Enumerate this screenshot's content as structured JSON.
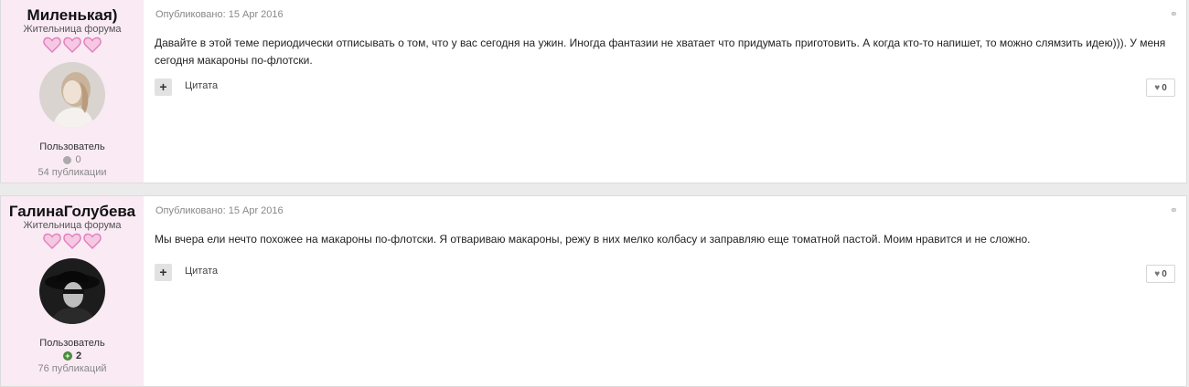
{
  "posts": [
    {
      "author": {
        "name": "Миленькая)",
        "title": "Жительница форума",
        "group": "Пользователь",
        "reputation": "0",
        "publications": "54 публикации"
      },
      "published": "Опубликовано: 15 Apr 2016",
      "text": "Давайте в этой теме периодически отписывать о том, что у вас сегодня на ужин. Иногда фантазии не хватает что придумать приготовить. А когда кто-то напишет, то можно слямзить идею))). У меня сегодня макароны по-флотски.",
      "quote_label": "Цитата",
      "multiquote_label": "+",
      "likes": "0"
    },
    {
      "author": {
        "name": "ГалинаГолубева",
        "title": "Жительница форума",
        "group": "Пользователь",
        "reputation": "2",
        "publications": "76 публикаций"
      },
      "published": "Опубликовано: 15 Apr 2016",
      "text": "Мы вчера ели нечто похожее на макароны по-флотски. Я отвариваю макароны, режу в них мелко колбасу и заправляю еще томатной пастой. Моим нравится и не сложно.",
      "quote_label": "Цитата",
      "multiquote_label": "+",
      "likes": "0"
    }
  ],
  "icons": {
    "rank": "heart-icon",
    "share": "share-icon",
    "like": "heart-outline-icon",
    "reputation_neutral": "neutral-dot-icon",
    "reputation_positive": "plus-circle-icon"
  },
  "colors": {
    "author_bg": "#f9eaf4",
    "heart": "#ea9acb",
    "page_bg": "#ebebeb"
  }
}
